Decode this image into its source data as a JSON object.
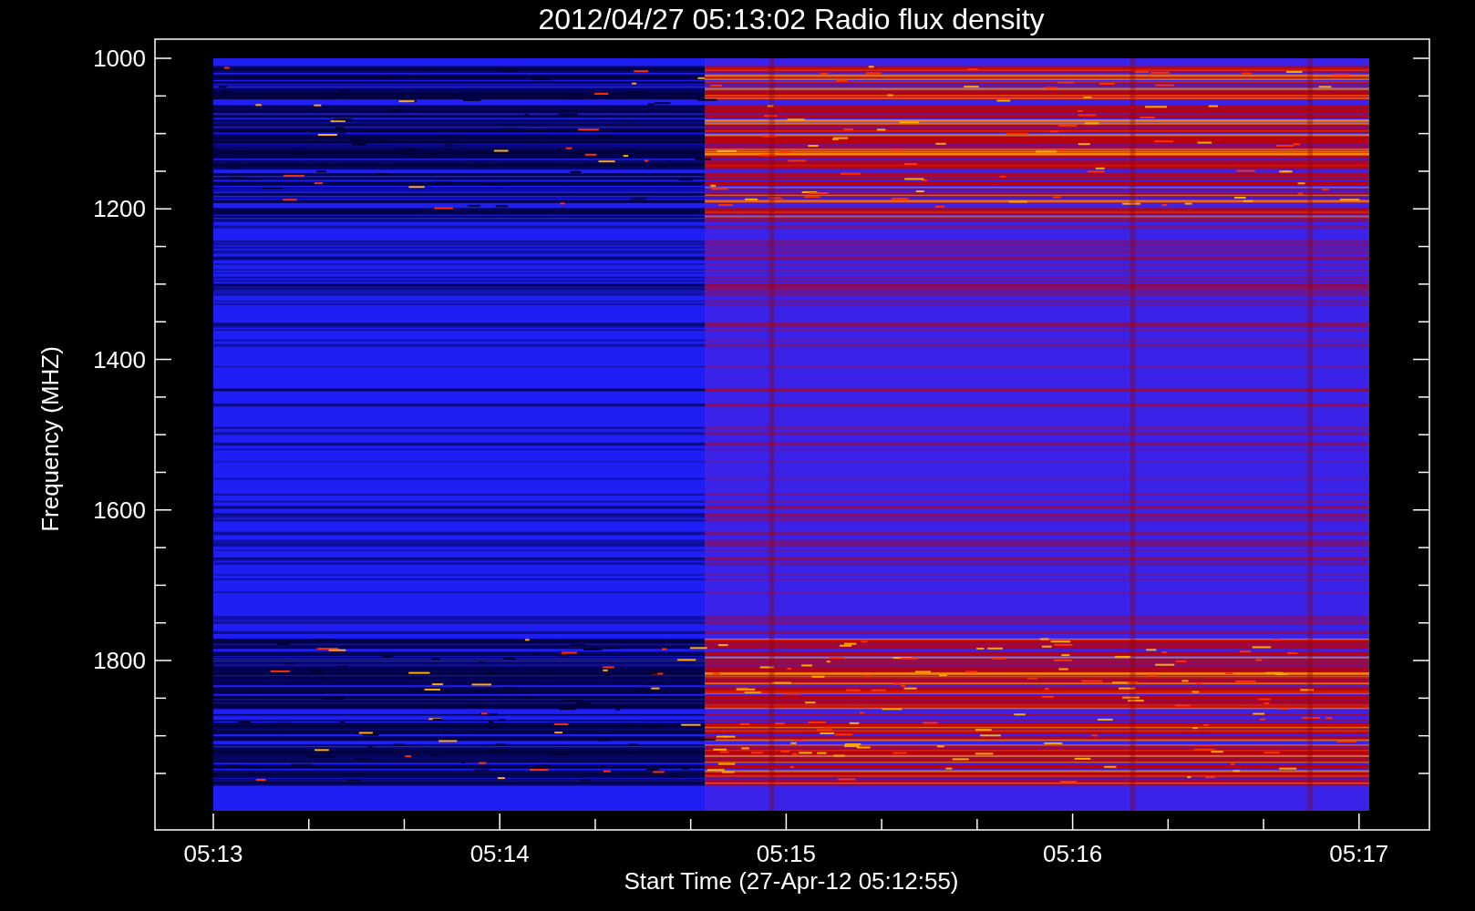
{
  "title": "2012/04/27 05:13:02 Radio flux density",
  "ylabel": "Frequency (MHZ)",
  "xlabel": "Start Time (27-Apr-12 05:12:55)",
  "yticks": [
    "1000",
    "1200",
    "1400",
    "1600",
    "1800"
  ],
  "xticks": [
    "05:13",
    "05:14",
    "05:15",
    "05:16",
    "05:17"
  ]
}
